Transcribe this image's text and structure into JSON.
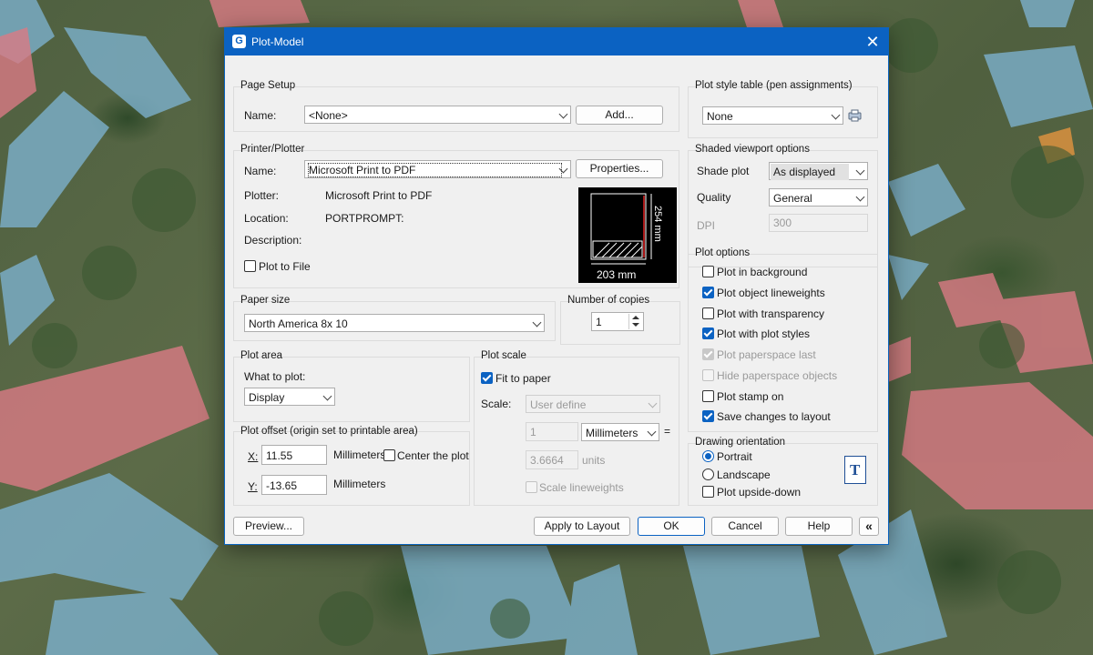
{
  "window": {
    "title": "Plot-Model",
    "app_icon": "G",
    "close_glyph": "✕"
  },
  "page_setup": {
    "group": "Page Setup",
    "name_label": "Name:",
    "name_value": "<None>",
    "add_button": "Add..."
  },
  "printer": {
    "group": "Printer/Plotter",
    "name_label": "Name:",
    "name_value": "Microsoft Print to PDF",
    "properties_button": "Properties...",
    "plotter_label": "Plotter:",
    "plotter_value": "Microsoft Print to PDF",
    "location_label": "Location:",
    "location_value": "PORTPROMPT:",
    "description_label": "Description:",
    "plot_to_file": "Plot to File",
    "preview_width": "203 mm",
    "preview_height": "254 mm"
  },
  "paper_size": {
    "group": "Paper size",
    "value": "North America 8x 10"
  },
  "copies": {
    "group": "Number of copies",
    "value": "1"
  },
  "plot_area": {
    "group": "Plot area",
    "what_label": "What to plot:",
    "what_value": "Display"
  },
  "plot_scale": {
    "group": "Plot scale",
    "fit_to_paper": "Fit to paper",
    "scale_label": "Scale:",
    "scale_value": "User define",
    "value1": "1",
    "unit1": "Millimeters",
    "equals": "=",
    "value2": "3.6664",
    "unit2": "units",
    "scale_lineweights": "Scale lineweights"
  },
  "plot_offset": {
    "group": "Plot offset (origin set to printable area)",
    "x_label": "X:",
    "x_value": "11.55",
    "x_unit": "Millimeters",
    "center": "Center the plot",
    "y_label": "Y:",
    "y_value": "-13.65",
    "y_unit": "Millimeters"
  },
  "style_table": {
    "group": "Plot style table (pen assignments)",
    "value": "None"
  },
  "shaded": {
    "group": "Shaded viewport options",
    "shade_label": "Shade plot",
    "shade_value": "As displayed",
    "quality_label": "Quality",
    "quality_value": "General",
    "dpi_label": "DPI",
    "dpi_value": "300"
  },
  "plot_options": {
    "group": "Plot options",
    "items": [
      {
        "label": "Plot in background",
        "checked": false
      },
      {
        "label": "Plot object lineweights",
        "checked": true
      },
      {
        "label": "Plot with transparency",
        "checked": false
      },
      {
        "label": "Plot with plot styles",
        "checked": true
      },
      {
        "label": "Plot paperspace last",
        "checked": true,
        "disabled": true
      },
      {
        "label": "Hide paperspace objects",
        "checked": false,
        "disabled": true
      },
      {
        "label": "Plot stamp on",
        "checked": false
      },
      {
        "label": "Save changes to layout",
        "checked": true
      }
    ]
  },
  "orientation": {
    "group": "Drawing orientation",
    "portrait": "Portrait",
    "landscape": "Landscape",
    "upside_down": "Plot upside-down",
    "selected": "Portrait",
    "icon_letter": "T"
  },
  "footer": {
    "preview": "Preview...",
    "apply": "Apply to Layout",
    "ok": "OK",
    "cancel": "Cancel",
    "help": "Help",
    "collapse": "«"
  }
}
